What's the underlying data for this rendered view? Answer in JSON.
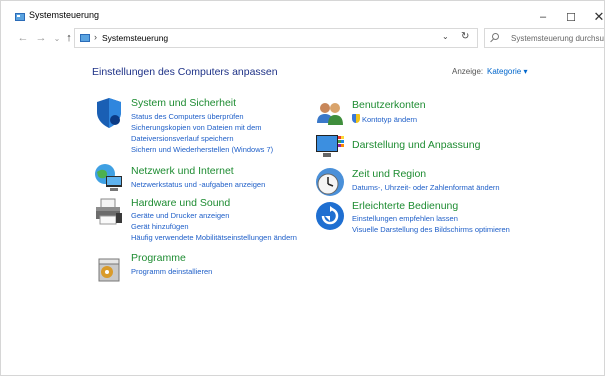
{
  "window": {
    "title": "Systemsteuerung"
  },
  "address": {
    "path": "Systemsteuerung"
  },
  "search": {
    "placeholder": "Systemsteuerung durchsuchen"
  },
  "content": {
    "heading": "Einstellungen des Computers anpassen",
    "view_label": "Anzeige:",
    "view_value": "Kategorie ▾"
  },
  "categories": {
    "system": {
      "title": "System und Sicherheit",
      "links": [
        "Status des Computers überprüfen",
        "Sicherungskopien von Dateien mit dem",
        "Dateiversionsverlauf speichern",
        "Sichern und Wiederherstellen (Windows 7)"
      ]
    },
    "network": {
      "title": "Netzwerk und Internet",
      "links": [
        "Netzwerkstatus und -aufgaben anzeigen"
      ]
    },
    "hardware": {
      "title": "Hardware und Sound",
      "links": [
        "Geräte und Drucker anzeigen",
        "Gerät hinzufügen",
        "Häufig verwendete Mobilitätseinstellungen ändern"
      ]
    },
    "programs": {
      "title": "Programme",
      "links": [
        "Programm deinstallieren"
      ]
    },
    "users": {
      "title": "Benutzerkonten",
      "links": [
        "Kontotyp ändern"
      ]
    },
    "appearance": {
      "title": "Darstellung und Anpassung",
      "links": []
    },
    "clock": {
      "title": "Zeit und Region",
      "links": [
        "Datums-, Uhrzeit- oder Zahlenformat ändern"
      ]
    },
    "ease": {
      "title": "Erleichterte Bedienung",
      "links": [
        "Einstellungen empfehlen lassen",
        "Visuelle Darstellung des Bildschirms optimieren"
      ]
    }
  }
}
